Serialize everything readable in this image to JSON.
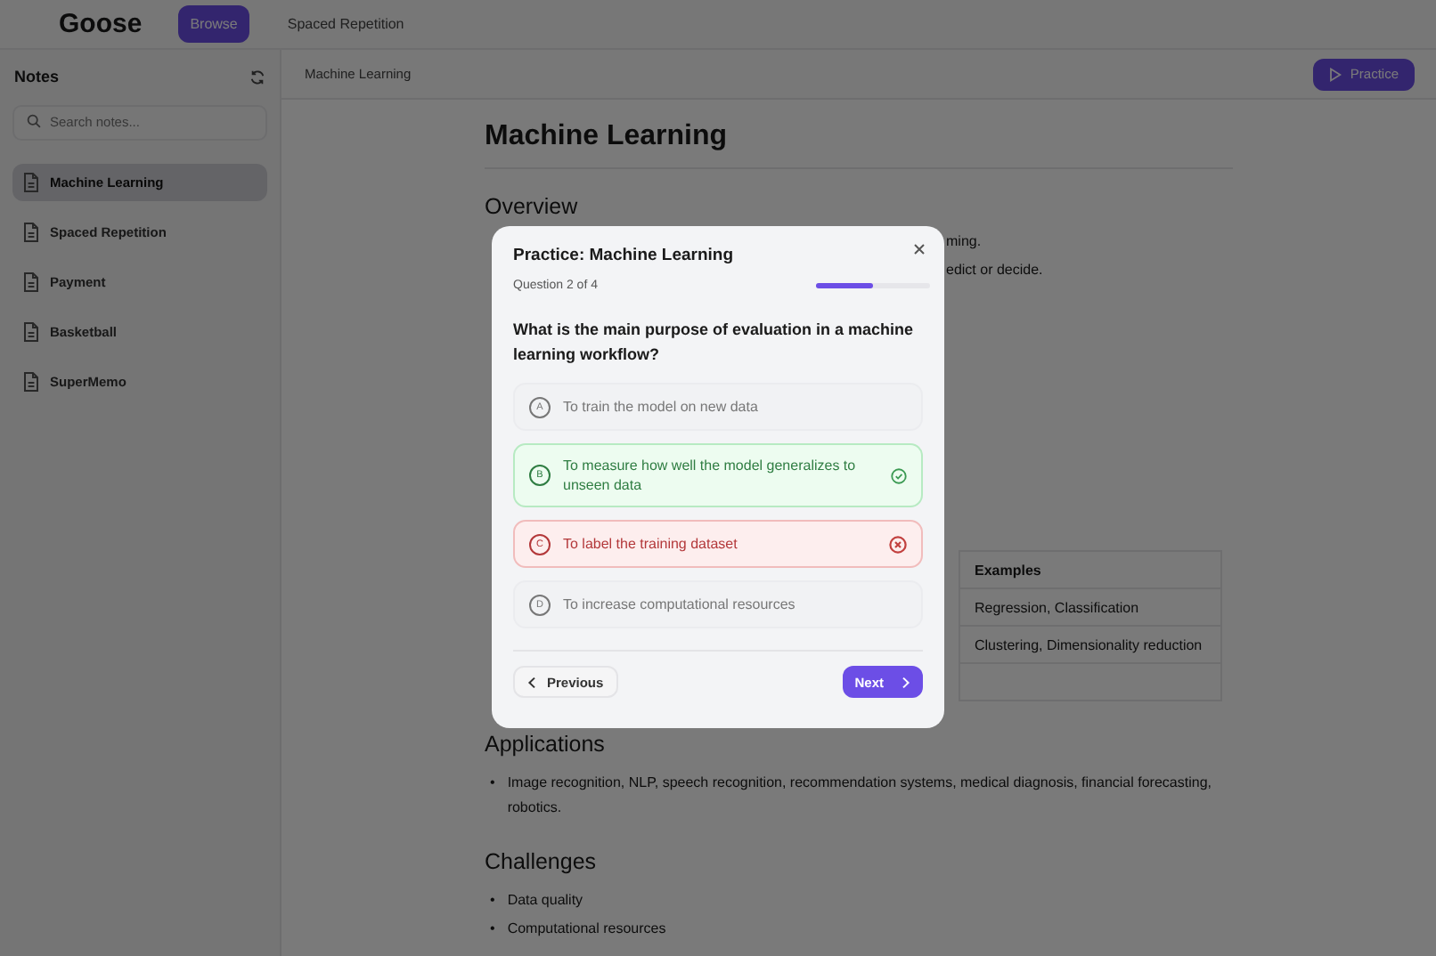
{
  "app": {
    "name": "Goose",
    "nav": [
      {
        "label": "Browse",
        "selected": true
      },
      {
        "label": "Spaced Repetition",
        "selected": false
      }
    ]
  },
  "sidebar": {
    "title": "Notes",
    "search": {
      "placeholder": "Search notes..."
    },
    "items": [
      {
        "label": "Machine Learning",
        "selected": true
      },
      {
        "label": "Spaced Repetition",
        "selected": false
      },
      {
        "label": "Payment",
        "selected": false
      },
      {
        "label": "Basketball",
        "selected": false
      },
      {
        "label": "SuperMemo",
        "selected": false
      }
    ]
  },
  "header": {
    "breadcrumb": "Machine Learning",
    "action": "Practice"
  },
  "note": {
    "title": "Machine Learning",
    "overview": {
      "heading": "Overview",
      "lines": [
        "ming.",
        "edict or decide."
      ]
    },
    "table": {
      "columns": [
        "Examples"
      ],
      "rows": [
        [
          "Regression, Classification"
        ],
        [
          "Clustering, Dimensionality reduction"
        ]
      ]
    },
    "applications": {
      "heading": "Applications",
      "items": [
        {
          "bullet": "•",
          "text": "Image recognition, NLP, speech recognition, recommendation systems, medical diagnosis, financial forecasting, robotics."
        }
      ]
    },
    "challenges": {
      "heading": "Challenges",
      "items": [
        {
          "bullet": "•",
          "text": "Data quality"
        },
        {
          "bullet": "•",
          "text": "Computational resources"
        }
      ]
    }
  },
  "modal": {
    "title": "Practice: Machine Learning",
    "progress_text": "Question 2 of 4",
    "progress": {
      "level": 0.5
    },
    "question": "What is the main purpose of evaluation in a machine learning workflow?",
    "options": [
      {
        "letter": "A",
        "text": "To train the model on new data",
        "kind": "neutral"
      },
      {
        "letter": "B",
        "text": "To measure how well the model generalizes to unseen data",
        "kind": "correct"
      },
      {
        "letter": "C",
        "text": "To label the training dataset",
        "kind": "wrong"
      },
      {
        "letter": "D",
        "text": "To increase computational resources",
        "kind": "neutral"
      }
    ],
    "previous": "Previous",
    "next": "Next"
  }
}
